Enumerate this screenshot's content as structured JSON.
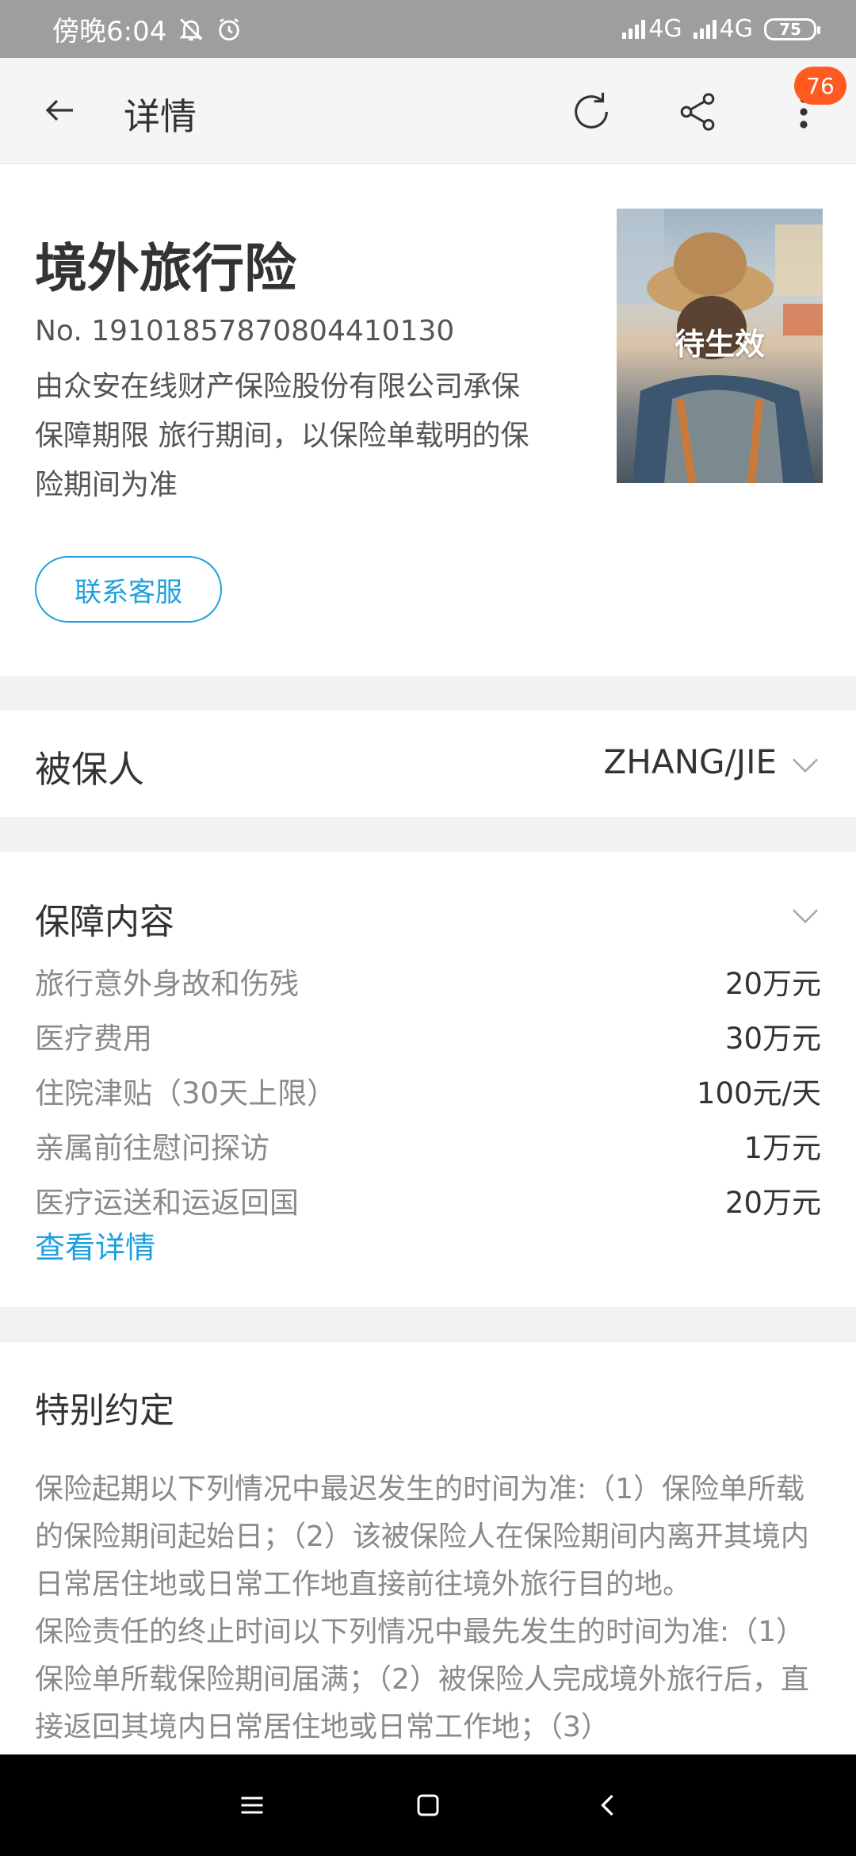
{
  "status_bar": {
    "time": "傍晚6:04",
    "network_1": "4G",
    "network_2": "4G",
    "battery": "75",
    "icons": [
      "mute-bell-icon",
      "alarm-icon",
      "signal-icon",
      "battery-icon"
    ]
  },
  "app_bar": {
    "title": "详情",
    "badge_count": "76",
    "icons": [
      "back-arrow-icon",
      "refresh-icon",
      "share-icon",
      "more-vertical-icon"
    ]
  },
  "policy": {
    "product_name": "境外旅行险",
    "policy_number": "No. 19101857870804410130",
    "description_line1": "由众安在线财产保险股份有限公司承保",
    "description_line2": "保障期限 旅行期间，以保险单载明的保",
    "description_line3": "险期间为准",
    "status": "待生效",
    "contact_button": "联系客服"
  },
  "insured": {
    "label": "被保人",
    "value": "ZHANG/JIE"
  },
  "coverage": {
    "title": "保障内容",
    "items": [
      {
        "name": "旅行意外身故和伤残",
        "amount": "20万元"
      },
      {
        "name": "医疗费用",
        "amount": "30万元"
      },
      {
        "name": "住院津贴（30天上限）",
        "amount": "100元/天"
      },
      {
        "name": "亲属前往慰问探访",
        "amount": "1万元"
      },
      {
        "name": "医疗运送和运返回国",
        "amount": "20万元"
      }
    ],
    "details_link": "查看详情"
  },
  "special": {
    "title": "特别约定",
    "paragraph1": "保险起期以下列情况中最迟发生的时间为准:（1）保险单所载的保险期间起始日；（2）该被保险人在保险期间内离开其境内日常居住地或日常工作地直接前往境外旅行目的地。",
    "paragraph2": "保险责任的终止时间以下列情况中最先发生的时间为准:（1）保险单所载保险期间届满；（2）被保险人完成境外旅行后，直接返回其境内日常居住地或日常工作地；（3）"
  },
  "colors": {
    "accent": "#1f9fe0",
    "badge": "#ff5a1f",
    "status_bar": "#9e9e9e"
  }
}
